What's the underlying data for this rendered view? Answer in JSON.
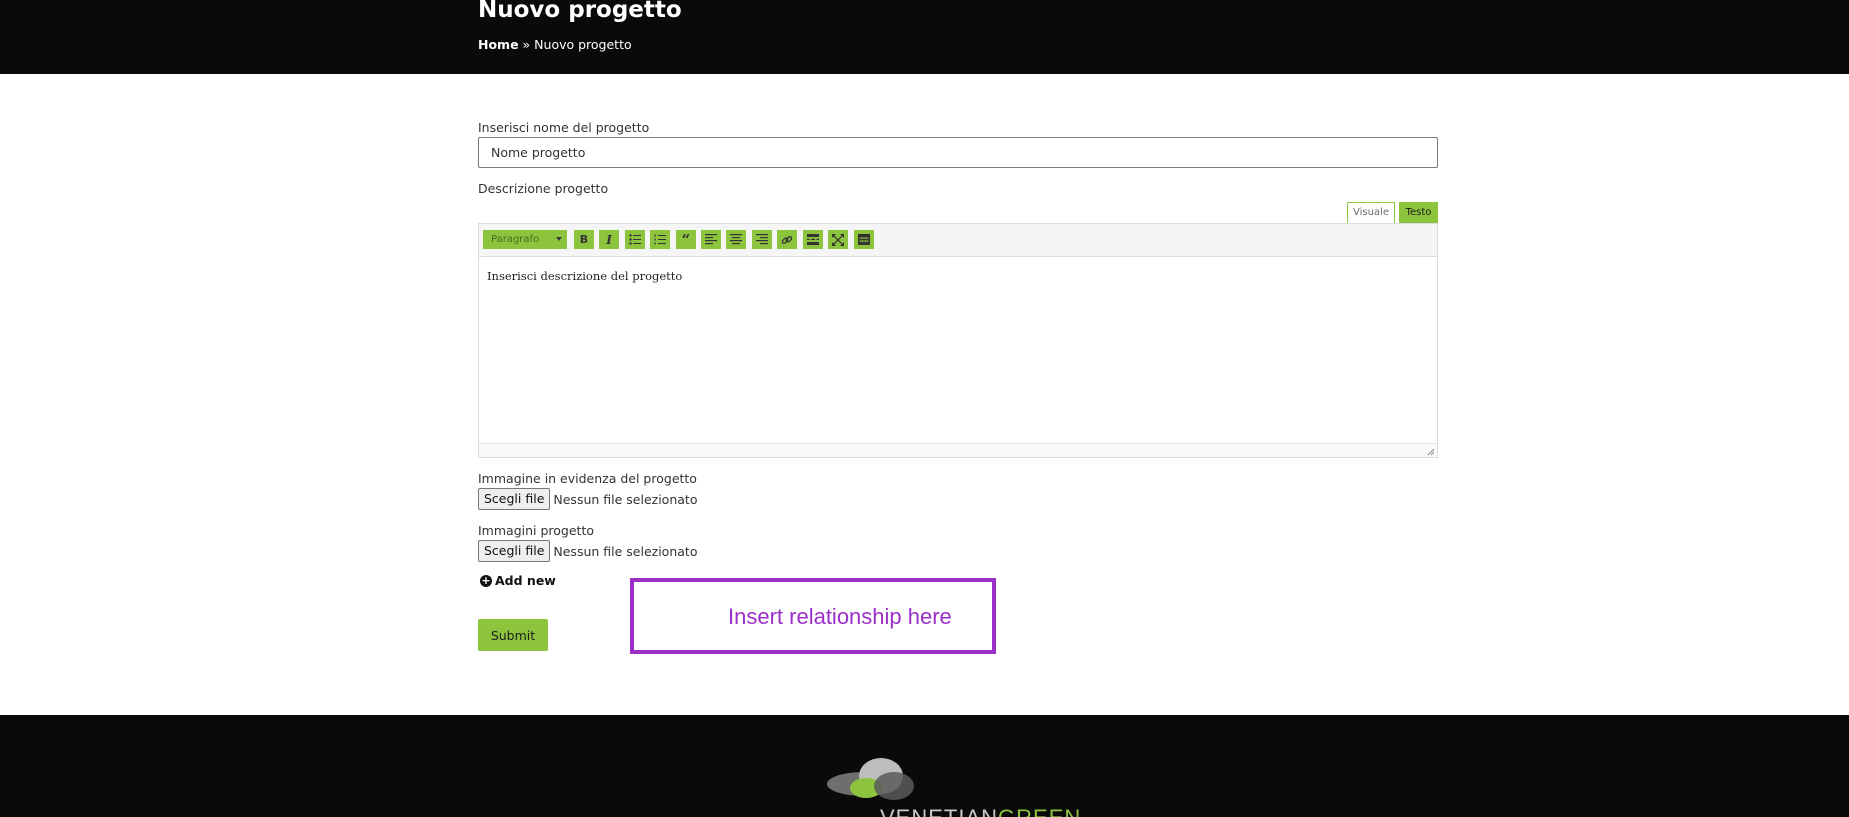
{
  "header": {
    "title": "Nuovo progetto",
    "breadcrumb": {
      "home": "Home",
      "separator": " » ",
      "current": "Nuovo progetto"
    }
  },
  "form": {
    "name_label": "Inserisci nome del progetto",
    "name_placeholder": "Nome progetto",
    "description_label": "Descrizione progetto",
    "editor": {
      "tab_visual": "Visuale",
      "tab_text": "Testo",
      "format_select": "Paragrafo",
      "content": "Inserisci descrizione del progetto",
      "toolbar_icons": [
        "bold-icon",
        "italic-icon",
        "bullet-list-icon",
        "numbered-list-icon",
        "blockquote-icon",
        "align-left-icon",
        "align-center-icon",
        "align-right-icon",
        "link-icon",
        "read-more-icon",
        "fullscreen-icon",
        "toolbar-toggle-icon"
      ]
    },
    "featured_image_label": "Immagine in evidenza del progetto",
    "featured_image_button": "Scegli file",
    "featured_image_status": "Nessun file selezionato",
    "images_label": "Immagini progetto",
    "images_button": "Scegli file",
    "images_status": "Nessun file selezionato",
    "add_new": "Add new",
    "submit": "Submit"
  },
  "annotation": {
    "text": "Insert relationship here",
    "color": "#9b2fc7"
  },
  "footer": {
    "logo_text_white": "VENETIAN",
    "logo_text_green": "GREEN"
  },
  "colors": {
    "accent": "#8cc43e",
    "header_bg": "#0b090a"
  }
}
